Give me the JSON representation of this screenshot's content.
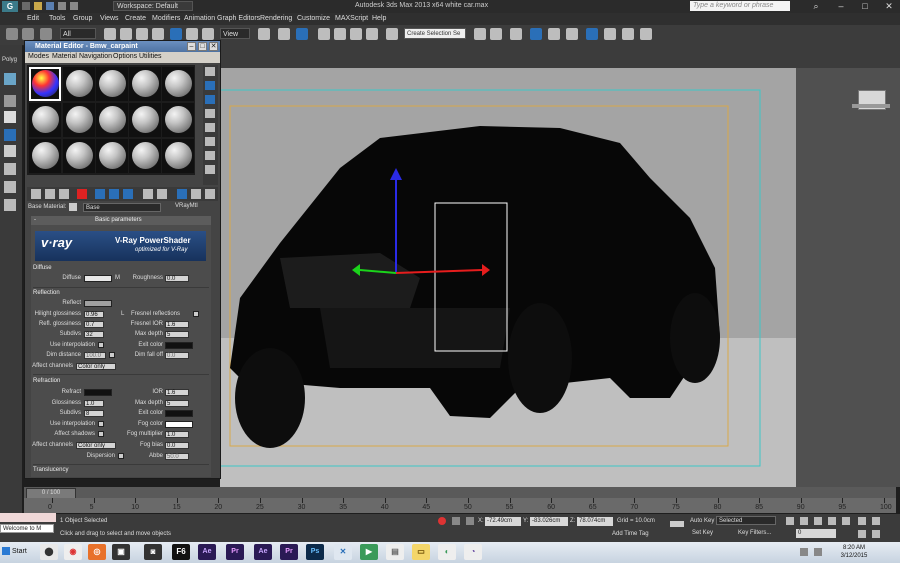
{
  "titlebar": {
    "logo": "G",
    "workspace": "Workspace: Default",
    "title": "Autodesk 3ds Max  2013 x64      white car.max",
    "search_placeholder": "Type a keyword or phrase"
  },
  "menubar": {
    "items": [
      "Edit",
      "Tools",
      "Group",
      "Views",
      "Create",
      "Modifiers",
      "Animation",
      "Graph Editors",
      "Rendering",
      "Customize",
      "MAXScript",
      "Help"
    ]
  },
  "toolbar": {
    "filter_value": "All",
    "view_value": "View",
    "selection_set_placeholder": "Create Selection Se"
  },
  "left_strip": {
    "label": "Polyg"
  },
  "material_editor": {
    "title": "Material Editor - Bmw_carpaint",
    "menu": [
      "Modes",
      "Material",
      "Navigation",
      "Options",
      "Utilities"
    ],
    "base_material_label": "Base Material:",
    "base_material_value": "Base",
    "material_type": "VRayMtl",
    "rollout_title": "Basic parameters",
    "banner_logo": "v·ray",
    "banner_title": "V-Ray PowerShader",
    "banner_subtitle": "optimized for V-Ray",
    "diffuse": {
      "group": "Diffuse",
      "diffuse_label": "Diffuse",
      "map_button": "M",
      "roughness_label": "Roughness",
      "roughness_value": "0.0",
      "diffuse_color": "#e8e8e8"
    },
    "reflection": {
      "group": "Reflection",
      "reflect_label": "Reflect",
      "reflect_color": "#a0a0a0",
      "hilight_label": "Hilight glossiness",
      "hilight_value": "0.96",
      "lock_label": "L",
      "fresnel_label": "Fresnel reflections",
      "refl_gloss_label": "Refl. glossiness",
      "refl_gloss_value": "0.7",
      "fresnel_ior_label": "Fresnel IOR",
      "fresnel_ior_value": "1.6",
      "subdivs_label": "Subdivs",
      "subdivs_value": "32",
      "max_depth_label": "Max depth",
      "max_depth_value": "5",
      "use_interp_label": "Use interpolation",
      "exit_color_label": "Exit color",
      "dim_distance_label": "Dim distance",
      "dim_distance_value": "100.0",
      "dim_falloff_label": "Dim fall off",
      "dim_falloff_value": "0.0",
      "affect_channels_label": "Affect channels",
      "affect_channels_value": "Color only"
    },
    "refraction": {
      "group": "Refraction",
      "refract_label": "Refract",
      "ior_label": "IOR",
      "ior_value": "1.6",
      "glossiness_label": "Glossiness",
      "glossiness_value": "1.0",
      "max_depth_label": "Max depth",
      "max_depth_value": "5",
      "subdivs_label": "Subdivs",
      "subdivs_value": "8",
      "exit_color_label": "Exit color",
      "use_interp_label": "Use interpolation",
      "fog_color_label": "Fog color",
      "affect_shadows_label": "Affect shadows",
      "fog_multiplier_label": "Fog multiplier",
      "fog_multiplier_value": "1.0",
      "affect_channels_label": "Affect channels",
      "affect_channels_value": "Color only",
      "fog_bias_label": "Fog bias",
      "fog_bias_value": "0.0",
      "dispersion_label": "Dispersion",
      "abbe_label": "Abbe",
      "abbe_value": "50.0"
    },
    "translucency_group": "Translucency"
  },
  "timeline": {
    "frame_readout": "0 / 100",
    "ticks": [
      "0",
      "5",
      "10",
      "15",
      "20",
      "25",
      "30",
      "35",
      "40",
      "45",
      "50",
      "55",
      "60",
      "65",
      "70",
      "75",
      "80",
      "85",
      "90",
      "95",
      "100"
    ]
  },
  "status": {
    "listener_top": "",
    "listener_bottom": "Welcome to M",
    "selected_text": "1 Object Selected",
    "prompt_text": "Click and drag to select and move objects",
    "x_label": "X:",
    "x_value": "-72.49cm",
    "y_label": "Y:",
    "y_value": "-83.026cm",
    "z_label": "Z:",
    "z_value": "78.074cm",
    "grid_text": "Grid = 10.0cm",
    "add_time_tag": "Add Time Tag",
    "auto_key": "Auto Key",
    "set_key": "Set Key",
    "key_mode_value": "Selected",
    "key_filters": "Key Filters...",
    "current_frame": "0"
  },
  "taskbar": {
    "start_label": "Start",
    "time": "8:20 AM",
    "date": "3/12/2015"
  },
  "colors": {
    "accent_blue": "#2a6fb8",
    "vray_banner": "#2a4f86"
  }
}
